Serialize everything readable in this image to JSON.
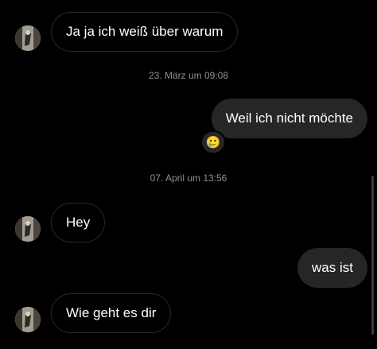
{
  "thread": {
    "messages": [
      {
        "direction": "incoming",
        "text": "Ja ja ich weiß über warum"
      },
      {
        "timestamp": "23. März um 09:08"
      },
      {
        "direction": "outgoing",
        "text": "Weil ich nicht möchte",
        "reaction": "🥲"
      },
      {
        "timestamp": "07. April um 13:56"
      },
      {
        "direction": "incoming",
        "text": "Hey"
      },
      {
        "direction": "outgoing",
        "text": "was ist"
      },
      {
        "direction": "incoming",
        "text": "Wie geht es dir"
      }
    ]
  },
  "colors": {
    "background": "#000000",
    "outgoing_bubble": "#262626",
    "incoming_border": "#2a2a2a",
    "timestamp_text": "#8e8e8e"
  },
  "icons": {
    "avatar": "contact-avatar-photo",
    "reaction": "smiling-face-with-tear-emoji"
  }
}
